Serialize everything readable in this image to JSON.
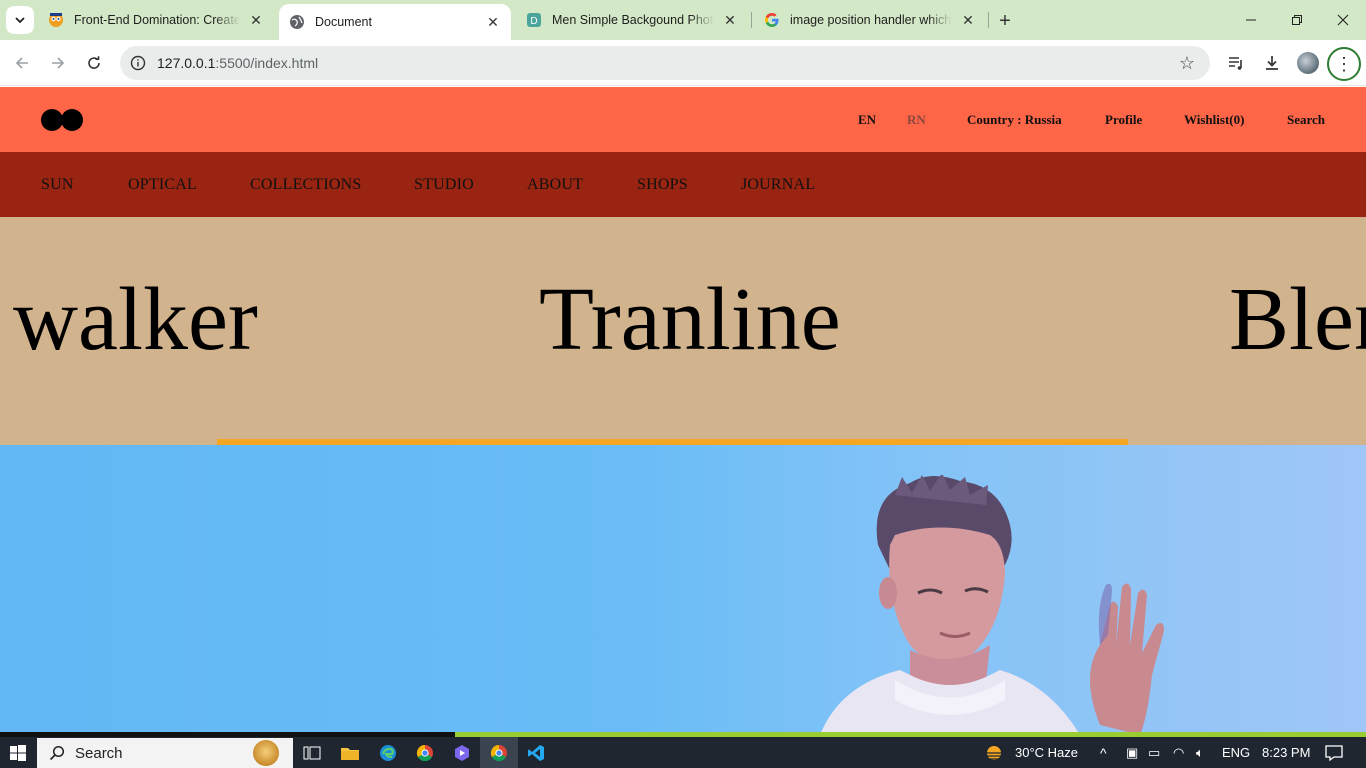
{
  "browser": {
    "tabs": [
      {
        "title": "Front-End Domination: Create A",
        "favicon": "owl-favicon-icon",
        "active": false
      },
      {
        "title": "Document",
        "favicon": "globe-icon",
        "active": true
      },
      {
        "title": "Men Simple Backgound Photos",
        "favicon": "d-favicon-icon",
        "active": false
      },
      {
        "title": "image position handler which p",
        "favicon": "google-g-icon",
        "active": false
      }
    ],
    "url_host": "127.0.0.1",
    "url_rest": ":5500/index.html"
  },
  "site": {
    "top_links": {
      "en": "EN",
      "rn": "RN",
      "country": "Country : Russia",
      "profile": "Profile",
      "wishlist": "Wishlist(0)",
      "search": "Search"
    },
    "nav": [
      "SUN",
      "OPTICAL",
      "COLLECTIONS",
      "STUDIO",
      "ABOUT",
      "SHOPS",
      "JOURNAL"
    ],
    "brand_words": [
      "walker",
      "Tranline",
      "Blen"
    ],
    "colors": {
      "topbar": "#ff6547",
      "nav": "#982411",
      "band": "#d1b38d",
      "underline": "#f5a623",
      "hero": "#69bcf6"
    }
  },
  "taskbar": {
    "search_label": "Search",
    "weather": "30°C  Haze",
    "lang": "ENG",
    "time": "8:23 PM"
  }
}
